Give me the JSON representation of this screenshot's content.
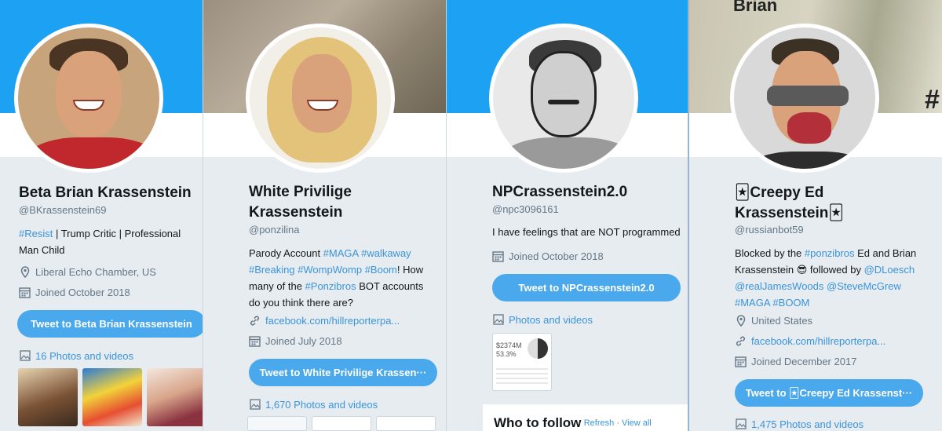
{
  "profiles": [
    {
      "name": "Beta Brian Krassenstein",
      "handle": "@BKrassenstein69",
      "bio": [
        {
          "text": "#Resist",
          "link": true
        },
        {
          "text": " | Trump Critic | Professional Man Child",
          "link": false
        }
      ],
      "location": "Liberal Echo Chamber, US",
      "joined": "Joined October 2018",
      "tweet_button": "Tweet to Beta Brian Krassenstein",
      "photos": "16 Photos and videos"
    },
    {
      "name": "White Privilige Krassenstein",
      "handle": "@ponzilina",
      "bio": [
        {
          "text": "Parody Account ",
          "link": false
        },
        {
          "text": "#MAGA",
          "link": true
        },
        {
          "text": " ",
          "link": false
        },
        {
          "text": "#walkaway",
          "link": true
        },
        {
          "text": " ",
          "link": false
        },
        {
          "text": "#Breaking",
          "link": true
        },
        {
          "text": " ",
          "link": false
        },
        {
          "text": "#WompWomp",
          "link": true
        },
        {
          "text": " ",
          "link": false
        },
        {
          "text": "#Boom",
          "link": true
        },
        {
          "text": "! How many of the ",
          "link": false
        },
        {
          "text": "#Ponzibros",
          "link": true
        },
        {
          "text": " BOT accounts do you think there are?",
          "link": false
        }
      ],
      "website": "facebook.com/hillreporterpa...",
      "joined": "Joined July 2018",
      "tweet_button": "Tweet to White Privilige Krassen···",
      "photos": "1,670 Photos and videos"
    },
    {
      "name": "NPCrassenstein2.0",
      "handle": "@npc3096161",
      "bio": [
        {
          "text": "I have feelings that are NOT programmed",
          "link": false
        }
      ],
      "joined": "Joined October 2018",
      "tweet_button": "Tweet to NPCrassenstein2.0",
      "photos": "Photos and videos",
      "thumb_text": [
        "$2374M",
        "53.3%"
      ]
    },
    {
      "name_line1": "🃏Creepy Ed",
      "name_line2": "Krassenstein🃏",
      "handle": "@russianbot59",
      "bio": [
        {
          "text": "Blocked by the ",
          "link": false
        },
        {
          "text": "#ponzibros",
          "link": true
        },
        {
          "text": " Ed and Brian Krassenstein 😎 followed by ",
          "link": false
        },
        {
          "text": "@DLoesch",
          "link": true
        },
        {
          "text": " ",
          "link": false
        },
        {
          "text": "@realJamesWoods",
          "link": true
        },
        {
          "text": " ",
          "link": false
        },
        {
          "text": "@SteveMcGrew",
          "link": true
        },
        {
          "text": " ",
          "link": false
        },
        {
          "text": "#MAGA",
          "link": true
        },
        {
          "text": " ",
          "link": false
        },
        {
          "text": "#BOOM",
          "link": true
        }
      ],
      "location": "United States",
      "website": "facebook.com/hillreporterpa...",
      "joined": "Joined December 2017",
      "tweet_button": "Tweet to 🃏Creepy Ed Krassenst···",
      "photos": "1,475 Photos and videos",
      "banner_text": "Brian",
      "banner_hash": "#"
    }
  ],
  "who_to_follow": {
    "title": "Who to follow",
    "refresh": "Refresh",
    "view_all": "View all"
  },
  "icons": {
    "location": "location-pin-icon",
    "calendar": "calendar-icon",
    "link": "link-icon",
    "photos": "photos-icon"
  },
  "colors": {
    "twitter_blue": "#1da1f2",
    "button_blue": "#4aa8ec",
    "link_blue": "#3b94d9",
    "background": "#e6ecf0"
  }
}
